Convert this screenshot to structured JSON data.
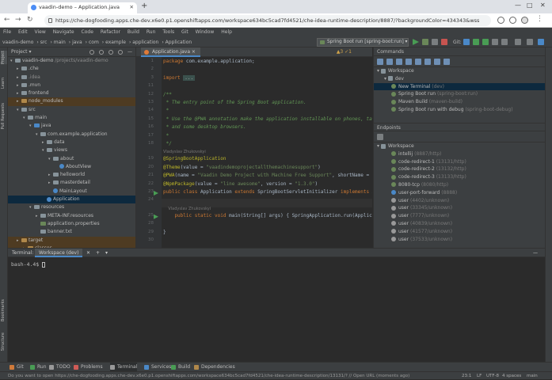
{
  "browser": {
    "tab_title": "vaadin-demo – Application.java",
    "url": "https://che-dogfooding.apps.che-dev.x6e0.p1.openshiftapps.com/workspace634bc5cad7fd4521/che-idea-runtime-description/8887/?backgroundColor=434343&wss"
  },
  "menu": [
    "File",
    "Edit",
    "View",
    "Navigate",
    "Code",
    "Refactor",
    "Build",
    "Run",
    "Tools",
    "Git",
    "Window",
    "Help"
  ],
  "breadcrumb": [
    "vaadin-demo",
    "src",
    "main",
    "java",
    "com",
    "example",
    "application",
    "Application"
  ],
  "run_config": "Spring Boot run [spring-boot:run]",
  "git_label": "Git:",
  "left_strip": [
    "Project",
    "Learn",
    "Pull Requests",
    "Bookmarks",
    "Structure"
  ],
  "project": {
    "title": "Project",
    "items": [
      {
        "indent": 0,
        "arrow": "▾",
        "label": "vaadin-demo",
        "extra": " /projects/vaadin-demo",
        "icon": "folder",
        "color": "#87939a",
        "style": ""
      },
      {
        "indent": 1,
        "arrow": "▸",
        "label": ".che",
        "icon": "folder",
        "color": "#87939a",
        "style": ""
      },
      {
        "indent": 1,
        "arrow": "▸",
        "label": ".idea",
        "icon": "folder",
        "color": "#87939a",
        "style": "dim"
      },
      {
        "indent": 1,
        "arrow": "▸",
        "label": ".mvn",
        "icon": "folder",
        "color": "#87939a",
        "style": ""
      },
      {
        "indent": 1,
        "arrow": "▸",
        "label": "frontend",
        "icon": "folder",
        "color": "#87939a",
        "style": ""
      },
      {
        "indent": 1,
        "arrow": "▸",
        "label": "node_modules",
        "icon": "folder",
        "color": "#b0884a",
        "style": "excl"
      },
      {
        "indent": 1,
        "arrow": "▾",
        "label": "src",
        "icon": "folder",
        "color": "#87939a",
        "style": ""
      },
      {
        "indent": 2,
        "arrow": "▾",
        "label": "main",
        "icon": "folder",
        "color": "#87939a",
        "style": ""
      },
      {
        "indent": 3,
        "arrow": "▾",
        "label": "java",
        "icon": "folder",
        "color": "#4a88c7",
        "style": ""
      },
      {
        "indent": 4,
        "arrow": "▾",
        "label": "com.example.application",
        "icon": "package",
        "color": "#87939a",
        "style": ""
      },
      {
        "indent": 5,
        "arrow": "▸",
        "label": "data",
        "icon": "package",
        "color": "#87939a",
        "style": ""
      },
      {
        "indent": 5,
        "arrow": "▾",
        "label": "views",
        "icon": "package",
        "color": "#87939a",
        "style": ""
      },
      {
        "indent": 6,
        "arrow": "▾",
        "label": "about",
        "icon": "package",
        "color": "#87939a",
        "style": ""
      },
      {
        "indent": 7,
        "arrow": "",
        "label": "AboutView",
        "icon": "class",
        "color": "#4a88c7",
        "style": ""
      },
      {
        "indent": 6,
        "arrow": "▸",
        "label": "helloworld",
        "icon": "package",
        "color": "#87939a",
        "style": ""
      },
      {
        "indent": 6,
        "arrow": "▸",
        "label": "masterdetail",
        "icon": "package",
        "color": "#87939a",
        "style": ""
      },
      {
        "indent": 6,
        "arrow": "",
        "label": "MainLayout",
        "icon": "class",
        "color": "#4a88c7",
        "style": ""
      },
      {
        "indent": 5,
        "arrow": "",
        "label": "Application",
        "icon": "class",
        "color": "#4a88c7",
        "style": ""
      },
      {
        "indent": 3,
        "arrow": "▾",
        "label": "resources",
        "icon": "folder",
        "color": "#87939a",
        "style": ""
      },
      {
        "indent": 4,
        "arrow": "▸",
        "label": "META-INF.resources",
        "icon": "package",
        "color": "#87939a",
        "style": ""
      },
      {
        "indent": 4,
        "arrow": "",
        "label": "application.properties",
        "icon": "file",
        "color": "#6a8759",
        "style": ""
      },
      {
        "indent": 4,
        "arrow": "",
        "label": "banner.txt",
        "icon": "file",
        "color": "#87939a",
        "style": ""
      },
      {
        "indent": 1,
        "arrow": "▸",
        "label": "target",
        "icon": "folder",
        "color": "#b0884a",
        "style": "excl"
      },
      {
        "indent": 2,
        "arrow": "▸",
        "label": "classes",
        "icon": "folder",
        "color": "#b0884a",
        "style": "excl"
      }
    ]
  },
  "editor": {
    "tab": "Application.java",
    "warnings": "▲3 ✓1",
    "lines": [
      {
        "n": "1",
        "t": [
          [
            "kw",
            "package "
          ],
          [
            "",
            "com.example.application;"
          ]
        ]
      },
      {
        "n": "2",
        "t": []
      },
      {
        "n": "3",
        "t": [
          [
            "kw",
            "import "
          ],
          [
            "fold",
            "..."
          ]
        ]
      },
      {
        "n": "11",
        "t": []
      },
      {
        "n": "12",
        "t": [
          [
            "cm",
            "/**"
          ]
        ]
      },
      {
        "n": "13",
        "t": [
          [
            "cm",
            " * The entry point of the Spring Boot application."
          ]
        ]
      },
      {
        "n": "14",
        "t": [
          [
            "cm",
            " *"
          ]
        ]
      },
      {
        "n": "15",
        "t": [
          [
            "cm",
            " * Use the @PWA annotation make the application installable on phones, tablets"
          ]
        ]
      },
      {
        "n": "16",
        "t": [
          [
            "cm",
            " * and some desktop browsers."
          ]
        ]
      },
      {
        "n": "17",
        "t": [
          [
            "cm",
            " *"
          ]
        ]
      },
      {
        "n": "18",
        "t": [
          [
            "cm",
            " */"
          ]
        ]
      },
      {
        "n": "",
        "t": [
          [
            "hint",
            "Vladyslav Zhukovskyi"
          ]
        ]
      },
      {
        "n": "19",
        "t": [
          [
            "an",
            "@SpringBootApplication"
          ]
        ]
      },
      {
        "n": "20",
        "t": [
          [
            "an",
            "@Theme"
          ],
          [
            "",
            "(value = "
          ],
          [
            "st",
            "\"vaadindemoprojectallthemachinesupport\""
          ],
          [
            "",
            ")"
          ]
        ]
      },
      {
        "n": "21",
        "t": [
          [
            "an",
            "@PWA"
          ],
          [
            "",
            "(name = "
          ],
          [
            "st",
            "\"Vaadin Demo Project with Machine Free Support\""
          ],
          [
            "",
            ", shortName = "
          ]
        ]
      },
      {
        "n": "22",
        "t": [
          [
            "an",
            "@NpmPackage"
          ],
          [
            "",
            "(value = "
          ],
          [
            "st",
            "\"line awesome\""
          ],
          [
            "",
            ", version = "
          ],
          [
            "st",
            "\"1.3.0\""
          ],
          [
            "",
            ")"
          ]
        ]
      },
      {
        "n": "23",
        "t": [
          [
            "kw",
            "public class "
          ],
          [
            "",
            "Application "
          ],
          [
            "kw",
            "extends "
          ],
          [
            "",
            "SpringBootServletInitializer "
          ],
          [
            "kw",
            "implements "
          ],
          [
            "",
            "AppShellConf"
          ]
        ]
      },
      {
        "n": "24",
        "t": []
      },
      {
        "n": "",
        "t": [
          [
            "hint",
            "    Vladyslav Zhukovskyi"
          ]
        ]
      },
      {
        "n": "25",
        "t": [
          [
            "kw",
            "    public static void "
          ],
          [
            "",
            "main(String[] args) { SpringApplication.run(Application.class, args)"
          ]
        ]
      },
      {
        "n": "28",
        "t": []
      },
      {
        "n": "29",
        "t": [
          [
            "",
            "}"
          ]
        ]
      },
      {
        "n": "30",
        "t": []
      }
    ]
  },
  "commands": {
    "title": "Commands",
    "items": [
      {
        "indent": 0,
        "arrow": "▾",
        "label": "Workspace",
        "hint": "",
        "sel": false
      },
      {
        "indent": 1,
        "arrow": "▾",
        "label": "dev",
        "hint": "",
        "sel": false
      },
      {
        "indent": 2,
        "arrow": "",
        "label": "New Terminal",
        "hint": "(dev)",
        "sel": true
      },
      {
        "indent": 2,
        "arrow": "",
        "label": "Spring Boot run",
        "hint": "(spring-boot:run)",
        "sel": false
      },
      {
        "indent": 2,
        "arrow": "",
        "label": "Maven Build",
        "hint": "(maven-build)",
        "sel": false
      },
      {
        "indent": 2,
        "arrow": "",
        "label": "Spring Boot run with debug",
        "hint": "(spring-boot-debug)",
        "sel": false
      }
    ]
  },
  "endpoints": {
    "title": "Endpoints",
    "items": [
      {
        "indent": 0,
        "label": "Workspace",
        "hint": "",
        "color": ""
      },
      {
        "indent": 1,
        "label": "intellij",
        "hint": "(8887/http)",
        "color": "#6a8759"
      },
      {
        "indent": 1,
        "label": "code-redirect-1",
        "hint": "(13131/http)",
        "color": "#6a8759"
      },
      {
        "indent": 1,
        "label": "code-redirect-2",
        "hint": "(13132/http)",
        "color": "#6a8759"
      },
      {
        "indent": 1,
        "label": "code-redirect-3",
        "hint": "(13133/http)",
        "color": "#6a8759"
      },
      {
        "indent": 1,
        "label": "8080-tcp",
        "hint": "(8080/http)",
        "color": "#6a8759"
      },
      {
        "indent": 1,
        "label": "user-port-forward",
        "hint": "(8888)",
        "color": "#4a88c7"
      },
      {
        "indent": 1,
        "label": "user",
        "hint": "(4402/unknown)",
        "color": "#999999"
      },
      {
        "indent": 1,
        "label": "user",
        "hint": "(33345/unknown)",
        "color": "#999999"
      },
      {
        "indent": 1,
        "label": "user",
        "hint": "(7777/unknown)",
        "color": "#999999"
      },
      {
        "indent": 1,
        "label": "user",
        "hint": "(40839/unknown)",
        "color": "#999999"
      },
      {
        "indent": 1,
        "label": "user",
        "hint": "(41577/unknown)",
        "color": "#999999"
      },
      {
        "indent": 1,
        "label": "user",
        "hint": "(37533/unknown)",
        "color": "#999999"
      }
    ]
  },
  "terminal": {
    "title": "Terminal:",
    "tab": "Workspace (dev)",
    "prompt": "bash-4.4$ "
  },
  "tool_strip": [
    {
      "label": "Git",
      "color": "#d07a3a",
      "active": false
    },
    {
      "label": "Run",
      "color": "#499c54",
      "active": false
    },
    {
      "label": "TODO",
      "color": "#999999",
      "active": false
    },
    {
      "label": "Problems",
      "color": "#cf5b56",
      "active": false
    },
    {
      "label": "Terminal",
      "color": "#999999",
      "active": true
    },
    {
      "label": "Services",
      "color": "#4a88c7",
      "active": false
    },
    {
      "label": "Build",
      "color": "#499c54",
      "active": false
    },
    {
      "label": "Dependencies",
      "color": "#b0884a",
      "active": false
    }
  ],
  "status": {
    "message": "Do you want to open https://che-dogfooding.apps.che-dev.x6e0.p1.openshiftapps.com/workspace634bc5cad7fd4521/che-idea-runtime-description/13131/? // Open URL (moments ago)",
    "position": "23:1",
    "line_sep": "LF",
    "encoding": "UTF-8",
    "indent": "4 spaces",
    "branch": "main"
  }
}
